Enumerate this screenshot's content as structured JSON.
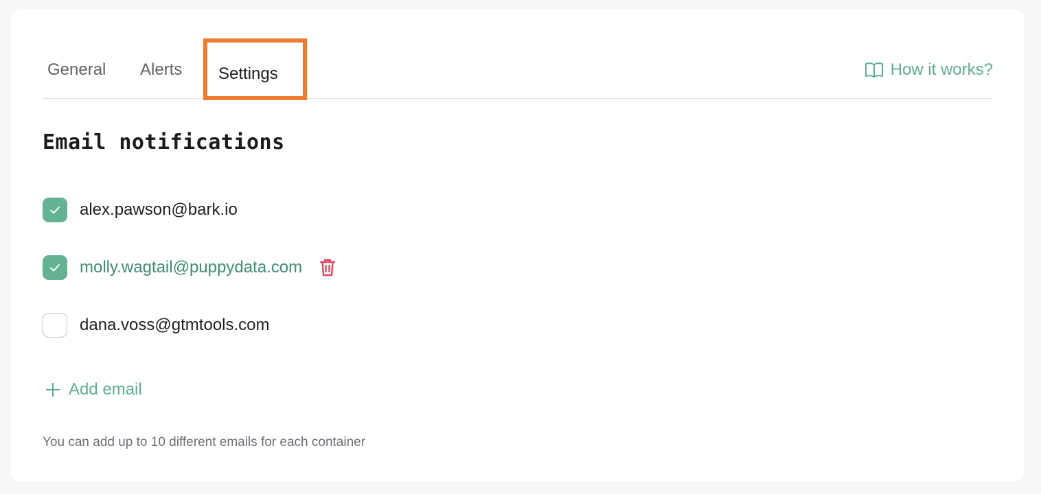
{
  "tabs": {
    "general": "General",
    "alerts": "Alerts",
    "settings": "Settings",
    "active": "Settings"
  },
  "help_link": {
    "label": "How it works?",
    "icon": "book-icon"
  },
  "section": {
    "title": "Email notifications"
  },
  "emails": [
    {
      "address": "alex.pawson@bark.io",
      "checked": true
    },
    {
      "address": "molly.wagtail@puppydata.com",
      "checked": true,
      "hovered": true,
      "delete_icon": "trash-icon"
    },
    {
      "address": "dana.voss@gtmtools.com",
      "checked": false
    }
  ],
  "add_email": {
    "label": "Add email",
    "icon": "plus-icon"
  },
  "hint": "You can add up to 10 different emails for each container",
  "colors": {
    "accent": "#5fb08e",
    "checkbox_checked": "#63b392",
    "highlight_box": "#ee7b30",
    "delete": "#e0475f"
  }
}
